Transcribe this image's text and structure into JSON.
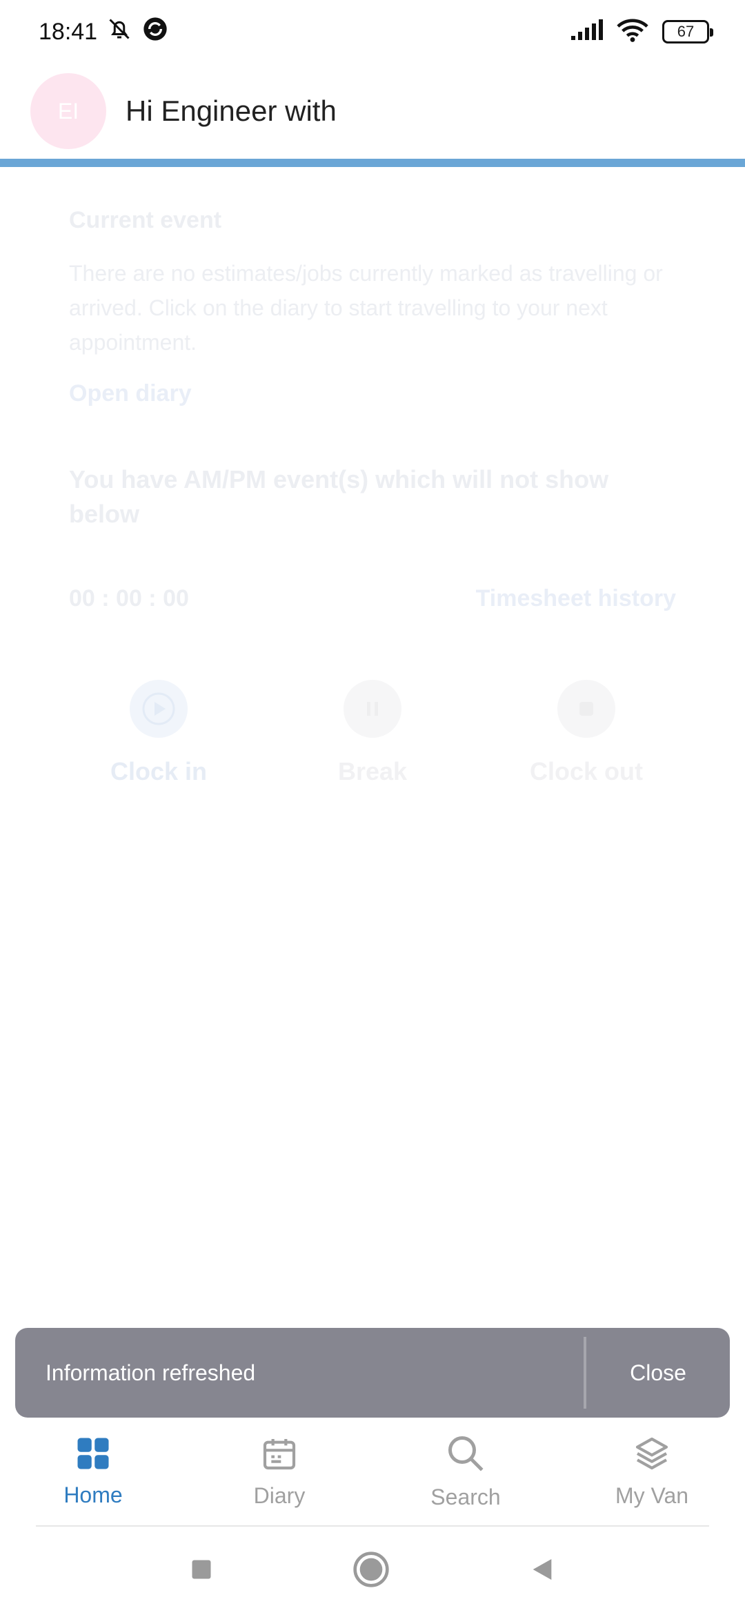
{
  "status_bar": {
    "time": "18:41",
    "battery": "67"
  },
  "header": {
    "avatar_initials": "EI",
    "greeting": "Hi Engineer with"
  },
  "current_event": {
    "title": "Current event",
    "message": "There are no estimates/jobs currently marked as travelling or arrived. Click on the diary to start travelling to your next appointment.",
    "open_diary": "Open diary"
  },
  "notice": "You have AM/PM event(s) which will not show below",
  "timesheet": {
    "timer": "00 : 00 : 00",
    "history_link": "Timesheet history"
  },
  "actions": {
    "clock_in": "Clock in",
    "break": "Break",
    "clock_out": "Clock out"
  },
  "snackbar": {
    "message": "Information refreshed",
    "close": "Close"
  },
  "bottom_nav": {
    "home": "Home",
    "diary": "Diary",
    "search": "Search",
    "my_van": "My Van",
    "active": "home",
    "active_color": "#2f7cc0",
    "inactive_color": "#a0a0a0"
  },
  "icons": [
    "bell-off-icon",
    "sync-icon",
    "signal-icon",
    "wifi-icon",
    "battery-icon",
    "play-icon",
    "pause-icon",
    "stop-icon",
    "grid-icon",
    "calendar-icon",
    "search-icon",
    "layers-icon",
    "recents-icon",
    "home-circle-icon",
    "back-icon"
  ]
}
